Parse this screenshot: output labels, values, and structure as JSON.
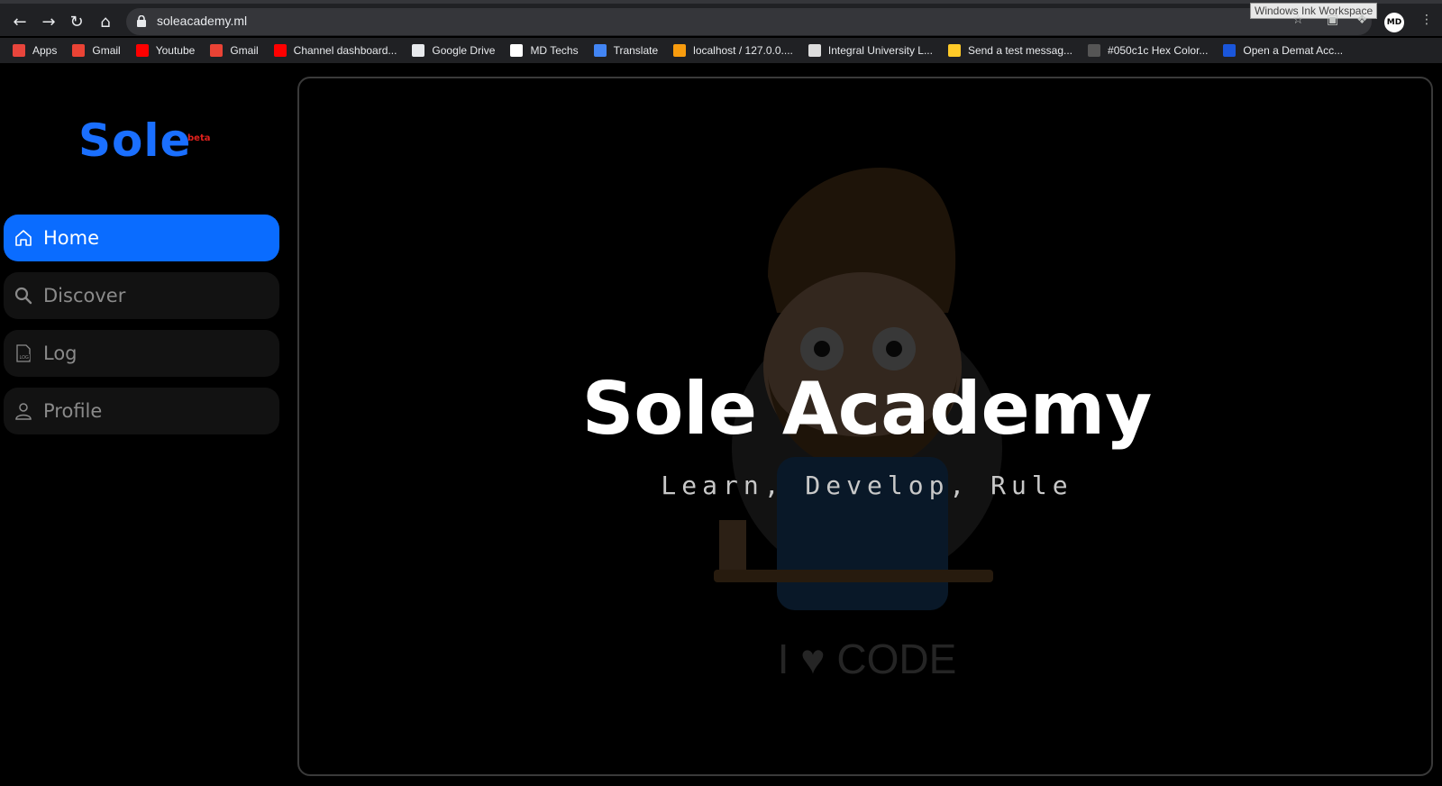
{
  "browser": {
    "url": "soleacademy.ml",
    "tooltip": "Windows Ink Workspace",
    "avatar_initials": "MD",
    "bookmarks": [
      {
        "label": "Apps",
        "icon": "apps-grid-icon",
        "color": "#e8453c"
      },
      {
        "label": "Gmail",
        "icon": "gmail-icon",
        "color": "#ea4335"
      },
      {
        "label": "Youtube",
        "icon": "youtube-icon",
        "color": "#ff0000"
      },
      {
        "label": "Gmail",
        "icon": "gmail-icon",
        "color": "#ea4335"
      },
      {
        "label": "Channel dashboard...",
        "icon": "youtube-icon",
        "color": "#ff0000"
      },
      {
        "label": "Google Drive",
        "icon": "globe-icon",
        "color": "#e8eaed"
      },
      {
        "label": "MD Techs",
        "icon": "md-techs-icon",
        "color": "#ffffff"
      },
      {
        "label": "Translate",
        "icon": "translate-icon",
        "color": "#4285f4"
      },
      {
        "label": "localhost / 127.0.0....",
        "icon": "phpmyadmin-icon",
        "color": "#f89c0e"
      },
      {
        "label": "Integral University L...",
        "icon": "university-icon",
        "color": "#dddddd"
      },
      {
        "label": "Send a test messag...",
        "icon": "firebase-icon",
        "color": "#ffca28"
      },
      {
        "label": "#050c1c Hex Color...",
        "icon": "color-icon",
        "color": "#555555"
      },
      {
        "label": "Open a Demat Acc...",
        "icon": "demat-icon",
        "color": "#1a56db"
      }
    ]
  },
  "sidebar": {
    "logo": "Sole",
    "badge": "beta",
    "items": [
      {
        "label": "Home",
        "icon": "home-icon",
        "active": true
      },
      {
        "label": "Discover",
        "icon": "search-icon",
        "active": false
      },
      {
        "label": "Log",
        "icon": "log-file-icon",
        "active": false
      },
      {
        "label": "Profile",
        "icon": "user-icon",
        "active": false
      }
    ]
  },
  "hero": {
    "title": "Sole Academy",
    "tagline": "Learn, Develop, Rule",
    "illustration_caption": "I ♥ CODE"
  },
  "colors": {
    "accent": "#0a6cff",
    "logo": "#1a6fff",
    "beta": "#e0201c"
  }
}
